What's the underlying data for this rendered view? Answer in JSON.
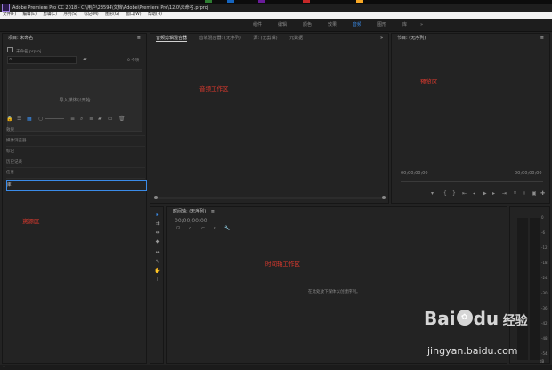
{
  "window": {
    "title": "Adobe Premiere Pro CC 2018 - C:\\用户\\23594\\文档\\Adobe\\Premiere Pro\\12.0\\未命名.prproj"
  },
  "menu": [
    "文件(F)",
    "编辑(E)",
    "剪辑(C)",
    "序列(S)",
    "标记(M)",
    "图形(G)",
    "窗口(W)",
    "帮助(H)"
  ],
  "workspaces": [
    {
      "label": "组件",
      "active": false
    },
    {
      "label": "编辑",
      "active": false
    },
    {
      "label": "颜色",
      "active": false
    },
    {
      "label": "效果",
      "active": false
    },
    {
      "label": "音频",
      "active": true
    },
    {
      "label": "图形",
      "active": false
    },
    {
      "label": "库",
      "active": false
    }
  ],
  "workspace_more": "»",
  "project": {
    "title": "项目: 未命名",
    "menu_icon": "≡",
    "file": "未命名.prproj",
    "search_placeholder": "",
    "item_count": "0 个项",
    "drop_hint": "导入媒体以开始",
    "panels_list": [
      "效果",
      "媒体浏览器",
      "标记",
      "历史记录",
      "信息",
      "库"
    ]
  },
  "labels": {
    "resource": "资源区",
    "audio_work": "音频工作区",
    "preview": "预览区",
    "timeline_work": "时间轴工作区"
  },
  "audio": {
    "tabs": [
      {
        "label": "音频剪辑混合器",
        "active": true
      },
      {
        "label": "音轨混合器: (无序列)",
        "active": false
      },
      {
        "label": "源: (无剪辑)",
        "active": false
      },
      {
        "label": "元数据",
        "active": false
      }
    ],
    "more": "»"
  },
  "program": {
    "title": "节目: (无序列)",
    "menu_icon": "≡",
    "timecode_left": "00;00;00;00",
    "timecode_right": "00;00;00;00"
  },
  "timeline": {
    "title": "时间轴: (无序列)",
    "menu_icon": "≡",
    "timecode": "00;00;00;00",
    "drop_hint": "在此处放下媒体以创建序列。"
  },
  "meter": {
    "scale": [
      "0",
      "-6",
      "-12",
      "-18",
      "-24",
      "-30",
      "-36",
      "-42",
      "-48",
      "-54"
    ],
    "unit": "dB"
  },
  "watermark": {
    "brand": "Bai",
    "brand2": "du",
    "cn": "经验",
    "url": "jingyan.baidu.com"
  },
  "colors": {
    "accent": "#3a8be8",
    "annotation": "#e23a2e"
  }
}
